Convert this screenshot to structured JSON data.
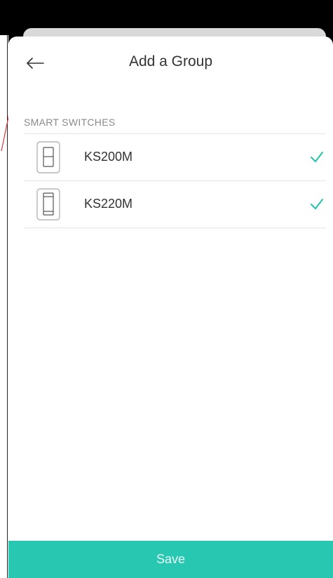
{
  "header": {
    "title": "Add a Group",
    "back_icon": "arrow-left-icon"
  },
  "section": {
    "title": "SMART SWITCHES"
  },
  "devices": [
    {
      "name": "KS200M",
      "icon": "light-switch-icon",
      "selected": true
    },
    {
      "name": "KS220M",
      "icon": "dimmer-switch-icon",
      "selected": true
    }
  ],
  "footer": {
    "save_label": "Save"
  },
  "colors": {
    "accent": "#27c7b1",
    "check": "#20c4ad",
    "text": "#333333",
    "muted": "#8a8a8a"
  }
}
